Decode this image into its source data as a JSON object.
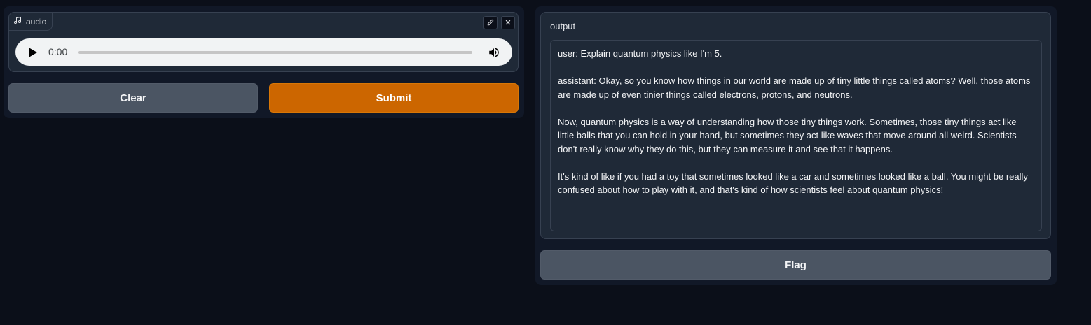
{
  "audio": {
    "label": "audio",
    "time": "0:00",
    "progress": 0
  },
  "buttons": {
    "clear": "Clear",
    "submit": "Submit",
    "flag": "Flag"
  },
  "output": {
    "label": "output",
    "paragraphs": [
      "user: Explain quantum physics like I'm 5.",
      "assistant: Okay, so you know how things in our world are made up of tiny little things called atoms? Well, those atoms are made up of even tinier things called electrons, protons, and neutrons.",
      "Now, quantum physics is a way of understanding how those tiny things work. Sometimes, those tiny things act like little balls that you can hold in your hand, but sometimes they act like waves that move around all weird. Scientists don't really know why they do this, but they can measure it and see that it happens.",
      "It's kind of like if you had a toy that sometimes looked like a car and sometimes looked like a ball. You might be really confused about how to play with it, and that's kind of how scientists feel about quantum physics!"
    ]
  },
  "colors": {
    "background": "#0b0f19",
    "panel": "#111827",
    "submit": "#cc6600",
    "secondary_button": "#4b5563"
  }
}
